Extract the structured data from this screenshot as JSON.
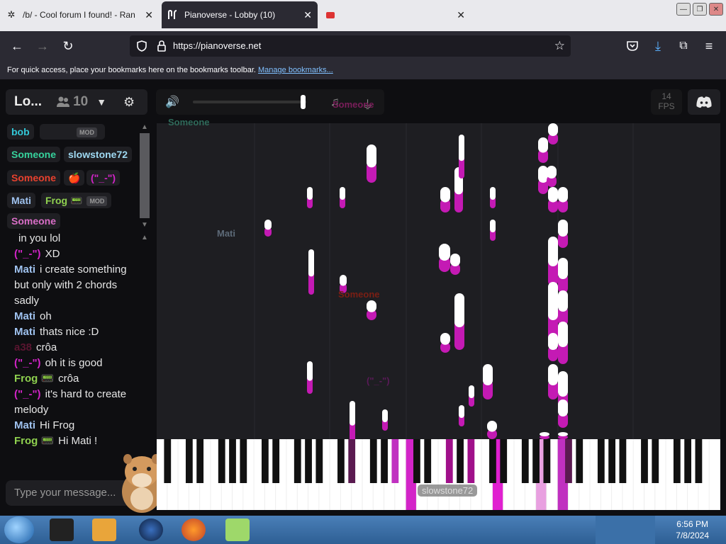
{
  "browser": {
    "tabs": [
      {
        "label": "/b/ - Cool forum I found! - Ran",
        "active": false
      },
      {
        "label": "Pianoverse - Lobby (10)",
        "active": true
      },
      {
        "label": "",
        "active": false
      }
    ],
    "url": "https://pianoverse.net",
    "bookmarks_text": "For quick access, place your bookmarks here on the bookmarks toolbar.",
    "bookmarks_link": "Manage bookmarks..."
  },
  "room": {
    "name": "Lo...",
    "count": "10"
  },
  "fps": {
    "value": "14",
    "label": "FPS"
  },
  "volume": 0.95,
  "users": [
    {
      "name": "bob",
      "color": "#33c8d8",
      "mod": false
    },
    {
      "name": "",
      "color": "#8a1f44",
      "mod": true,
      "mod_label": "MOD"
    },
    {
      "name": "Someone",
      "color": "#36d39d",
      "mod": false
    },
    {
      "name": "slowstone72",
      "color": "#9fd9f2",
      "mod": false
    },
    {
      "name": "Someone",
      "color": "#e8412e",
      "mod": false
    },
    {
      "name": "🍎",
      "color": "#d92a2a",
      "mod": false
    },
    {
      "name": "(\"_-\")",
      "color": "#d324c8",
      "mod": false
    },
    {
      "name": "Mati",
      "color": "#9fc2ef",
      "mod": false
    },
    {
      "name": "Frog 📟",
      "color": "#8fd14f",
      "mod": true,
      "mod_label": "MOD"
    },
    {
      "name": "Someone",
      "color": "#d96ec7",
      "mod": false
    }
  ],
  "chat": [
    {
      "name": "",
      "text": "in you lol",
      "color": "#e6e6e6"
    },
    {
      "name": "(\"_-\")",
      "text": "XD",
      "color": "#d324c8"
    },
    {
      "name": "Mati",
      "text": "i create something but only with 2 chords sadly",
      "color": "#9fc2ef"
    },
    {
      "name": "Mati",
      "text": "oh",
      "color": "#9fc2ef"
    },
    {
      "name": "Mati",
      "text": "thats nice :D",
      "color": "#9fc2ef"
    },
    {
      "name": "a38",
      "text": "crôa",
      "color": "#5a1530"
    },
    {
      "name": "(\"_-\")",
      "text": "oh it is good",
      "color": "#d324c8"
    },
    {
      "name": "Frog 📟",
      "text": "crôa",
      "color": "#8fd14f"
    },
    {
      "name": "(\"_-\")",
      "text": "it's hard to create melody",
      "color": "#d324c8"
    },
    {
      "name": "Mati",
      "text": "Hi Frog",
      "color": "#9fc2ef"
    },
    {
      "name": "Frog 📟",
      "text": "Hi Mati !",
      "color": "#8fd14f"
    }
  ],
  "chat_input": {
    "placeholder": "Type your message..."
  },
  "cursors": [
    {
      "label": "Someone",
      "color": "#2f6a5a"
    },
    {
      "label": "Mati",
      "color": "#5d6a78"
    },
    {
      "label": "Someone",
      "color": "#7a1e14"
    },
    {
      "label": "(\"_-\")",
      "color": "#5a1a58"
    },
    {
      "label": "slowstone72",
      "color": "#3a4a5a"
    },
    {
      "label": "Someone",
      "color": "#7a1e5a"
    }
  ],
  "taskbar": {
    "time": "6:56 PM",
    "date": "7/8/2024"
  },
  "colors": {
    "accent": "#d324c8",
    "note_glow": "#c41ab4"
  }
}
